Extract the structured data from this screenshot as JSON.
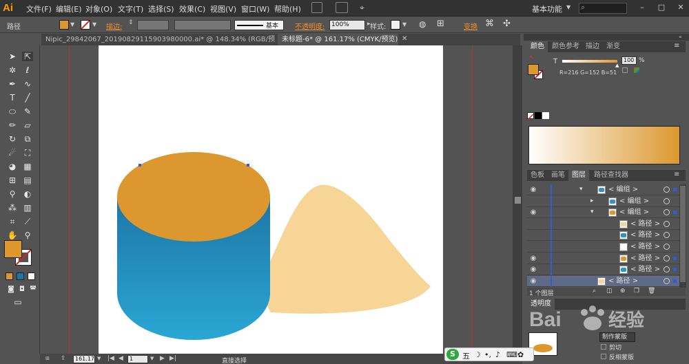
{
  "app": {
    "logo": "Ai"
  },
  "menu": [
    "文件(F)",
    "编辑(E)",
    "对象(O)",
    "文字(T)",
    "选择(S)",
    "效果(C)",
    "视图(V)",
    "窗口(W)",
    "帮助(H)"
  ],
  "workspace": "基本功能",
  "control": {
    "selection": "路径",
    "stroke_label": "描边:",
    "brush": "基本",
    "opacity_label": "不透明度:",
    "opacity_value": "100%",
    "style_label": "样式:",
    "transform_label": "变换"
  },
  "tabs": [
    {
      "label": "Nipic_29842067_20190829115903980000.ai* @ 148.34% (RGB/预览)",
      "active": false
    },
    {
      "label": "未标题-6* @ 161.17% (CMYK/预览)",
      "active": true
    }
  ],
  "color_panel": {
    "tabs": [
      "颜色",
      "颜色参考",
      "描边",
      "渐变"
    ],
    "channel": "T",
    "value": "100",
    "unit": "%",
    "rgb_readout": "R=216 G=152 B=51",
    "fill_color": "#dc982f",
    "ramp_start": "#ffffff",
    "ramp_end": "#dc982f"
  },
  "layers_panel": {
    "tabs": [
      "色板",
      "画笔",
      "图层",
      "路径查找器"
    ],
    "rows": [
      {
        "label": "< 编组 >",
        "indent": 1,
        "eye": true,
        "arrow": "▾",
        "thumb": "#3a8ec9"
      },
      {
        "label": "< 编组 >",
        "indent": 2,
        "eye": false,
        "arrow": "▸",
        "thumb": "#3a8ec9"
      },
      {
        "label": "< 编组 >",
        "indent": 2,
        "eye": true,
        "arrow": "▾",
        "thumb": "#dc982f"
      },
      {
        "label": "< 路径 >",
        "indent": 3,
        "eye": false,
        "arrow": "",
        "thumb": "#f6d597"
      },
      {
        "label": "< 路径 >",
        "indent": 3,
        "eye": false,
        "arrow": "",
        "thumb": "#2a94c4"
      },
      {
        "label": "< 路径 >",
        "indent": 3,
        "eye": false,
        "arrow": "",
        "thumb": "#ffffff"
      },
      {
        "label": "< 路径 >",
        "indent": 3,
        "eye": true,
        "arrow": "",
        "thumb": "#dc982f"
      },
      {
        "label": "< 路径 >",
        "indent": 3,
        "eye": true,
        "arrow": "",
        "thumb": "#2a94c4"
      },
      {
        "label": "< 路径 >",
        "indent": 1,
        "eye": true,
        "arrow": "",
        "thumb": "#f6d597"
      }
    ],
    "footer": "1 个图层"
  },
  "transparency_panel": {
    "tab": "透明度",
    "make_mask": "制作蒙版",
    "clip": "剪切",
    "invert": "反相蒙版"
  },
  "status": {
    "zoom": "161.17",
    "page": "1",
    "tool": "直接选择"
  },
  "art": {
    "cylinder_top": "#dc982f",
    "cylinder_body_top": "#1d76a6",
    "cylinder_body_bottom": "#2aa7d4",
    "sand": "#f6d597"
  },
  "ime": {
    "label": "五"
  }
}
